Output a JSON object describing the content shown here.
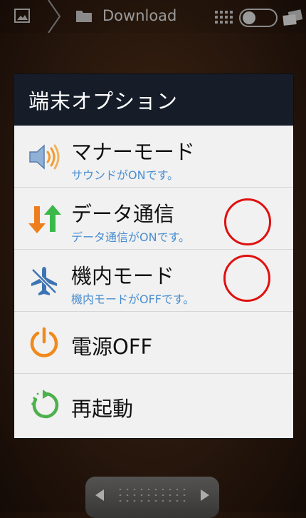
{
  "topbar": {
    "breadcrumb": "Download",
    "icons": [
      "gallery-icon",
      "chevron-right-icon",
      "folder-icon",
      "grid-icon",
      "toggle-switch",
      "stacked-cards-icon"
    ]
  },
  "dialog": {
    "title": "端末オプション",
    "options": [
      {
        "label": "マナーモード",
        "status": "サウンドがONです。",
        "icon": "speaker-icon"
      },
      {
        "label": "データ通信",
        "status": "データ通信がONです。",
        "icon": "data-transfer-icon"
      },
      {
        "label": "機内モード",
        "status": "機内モードがOFFです。",
        "icon": "airplane-off-icon"
      },
      {
        "label": "電源OFF",
        "icon": "power-icon"
      },
      {
        "label": "再起動",
        "icon": "restart-icon"
      }
    ]
  },
  "colors": {
    "header_bg": "#161d29",
    "status_text": "#4a8ed0",
    "annotation_circle": "#e01010",
    "power_orange": "#f08a1c",
    "restart_green": "#4cb04c"
  }
}
